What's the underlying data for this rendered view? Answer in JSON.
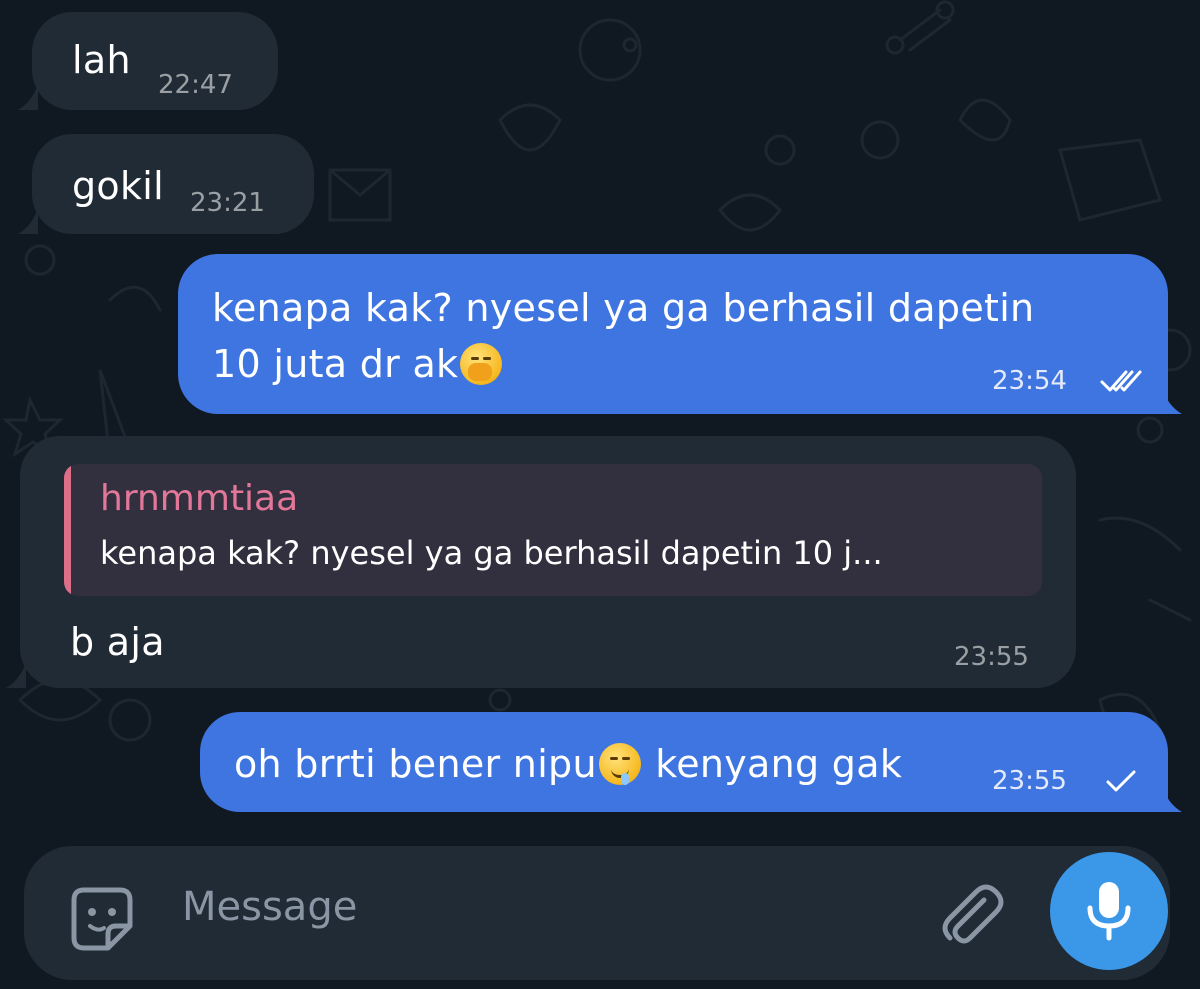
{
  "messages": [
    {
      "id": "m1",
      "direction": "incoming",
      "text": "lah",
      "time": "22:47"
    },
    {
      "id": "m2",
      "direction": "incoming",
      "text": "gokil",
      "time": "23:21"
    },
    {
      "id": "m3",
      "direction": "outgoing",
      "line1": "kenapa kak? nyesel ya ga berhasil  dapetin",
      "line2": "10 juta dr ak",
      "time": "23:54",
      "status": "read",
      "emoji": "yawning-face"
    },
    {
      "id": "m4",
      "direction": "incoming",
      "reply": {
        "name": "hrnmmtiaa",
        "text": "kenapa kak? nyesel ya ga berhasil  dapetin 10 j..."
      },
      "text": "b aja",
      "time": "23:55"
    },
    {
      "id": "m5",
      "direction": "outgoing",
      "part1": "oh brrti bener nipu",
      "part2": " kenyang gak",
      "time": "23:55",
      "status": "sent",
      "emoji": "drooling-face"
    }
  ],
  "composer": {
    "placeholder": "Message"
  },
  "icons": [
    "sticker-icon",
    "attach-paperclip-icon",
    "microphone-icon",
    "double-check-icon",
    "single-check-icon"
  ],
  "colors": {
    "background": "#101921",
    "incoming_bubble": "#202b36",
    "outgoing_bubble": "#3f75e0",
    "reply_name": "#e2779a",
    "mic_button": "#3b97e8"
  }
}
